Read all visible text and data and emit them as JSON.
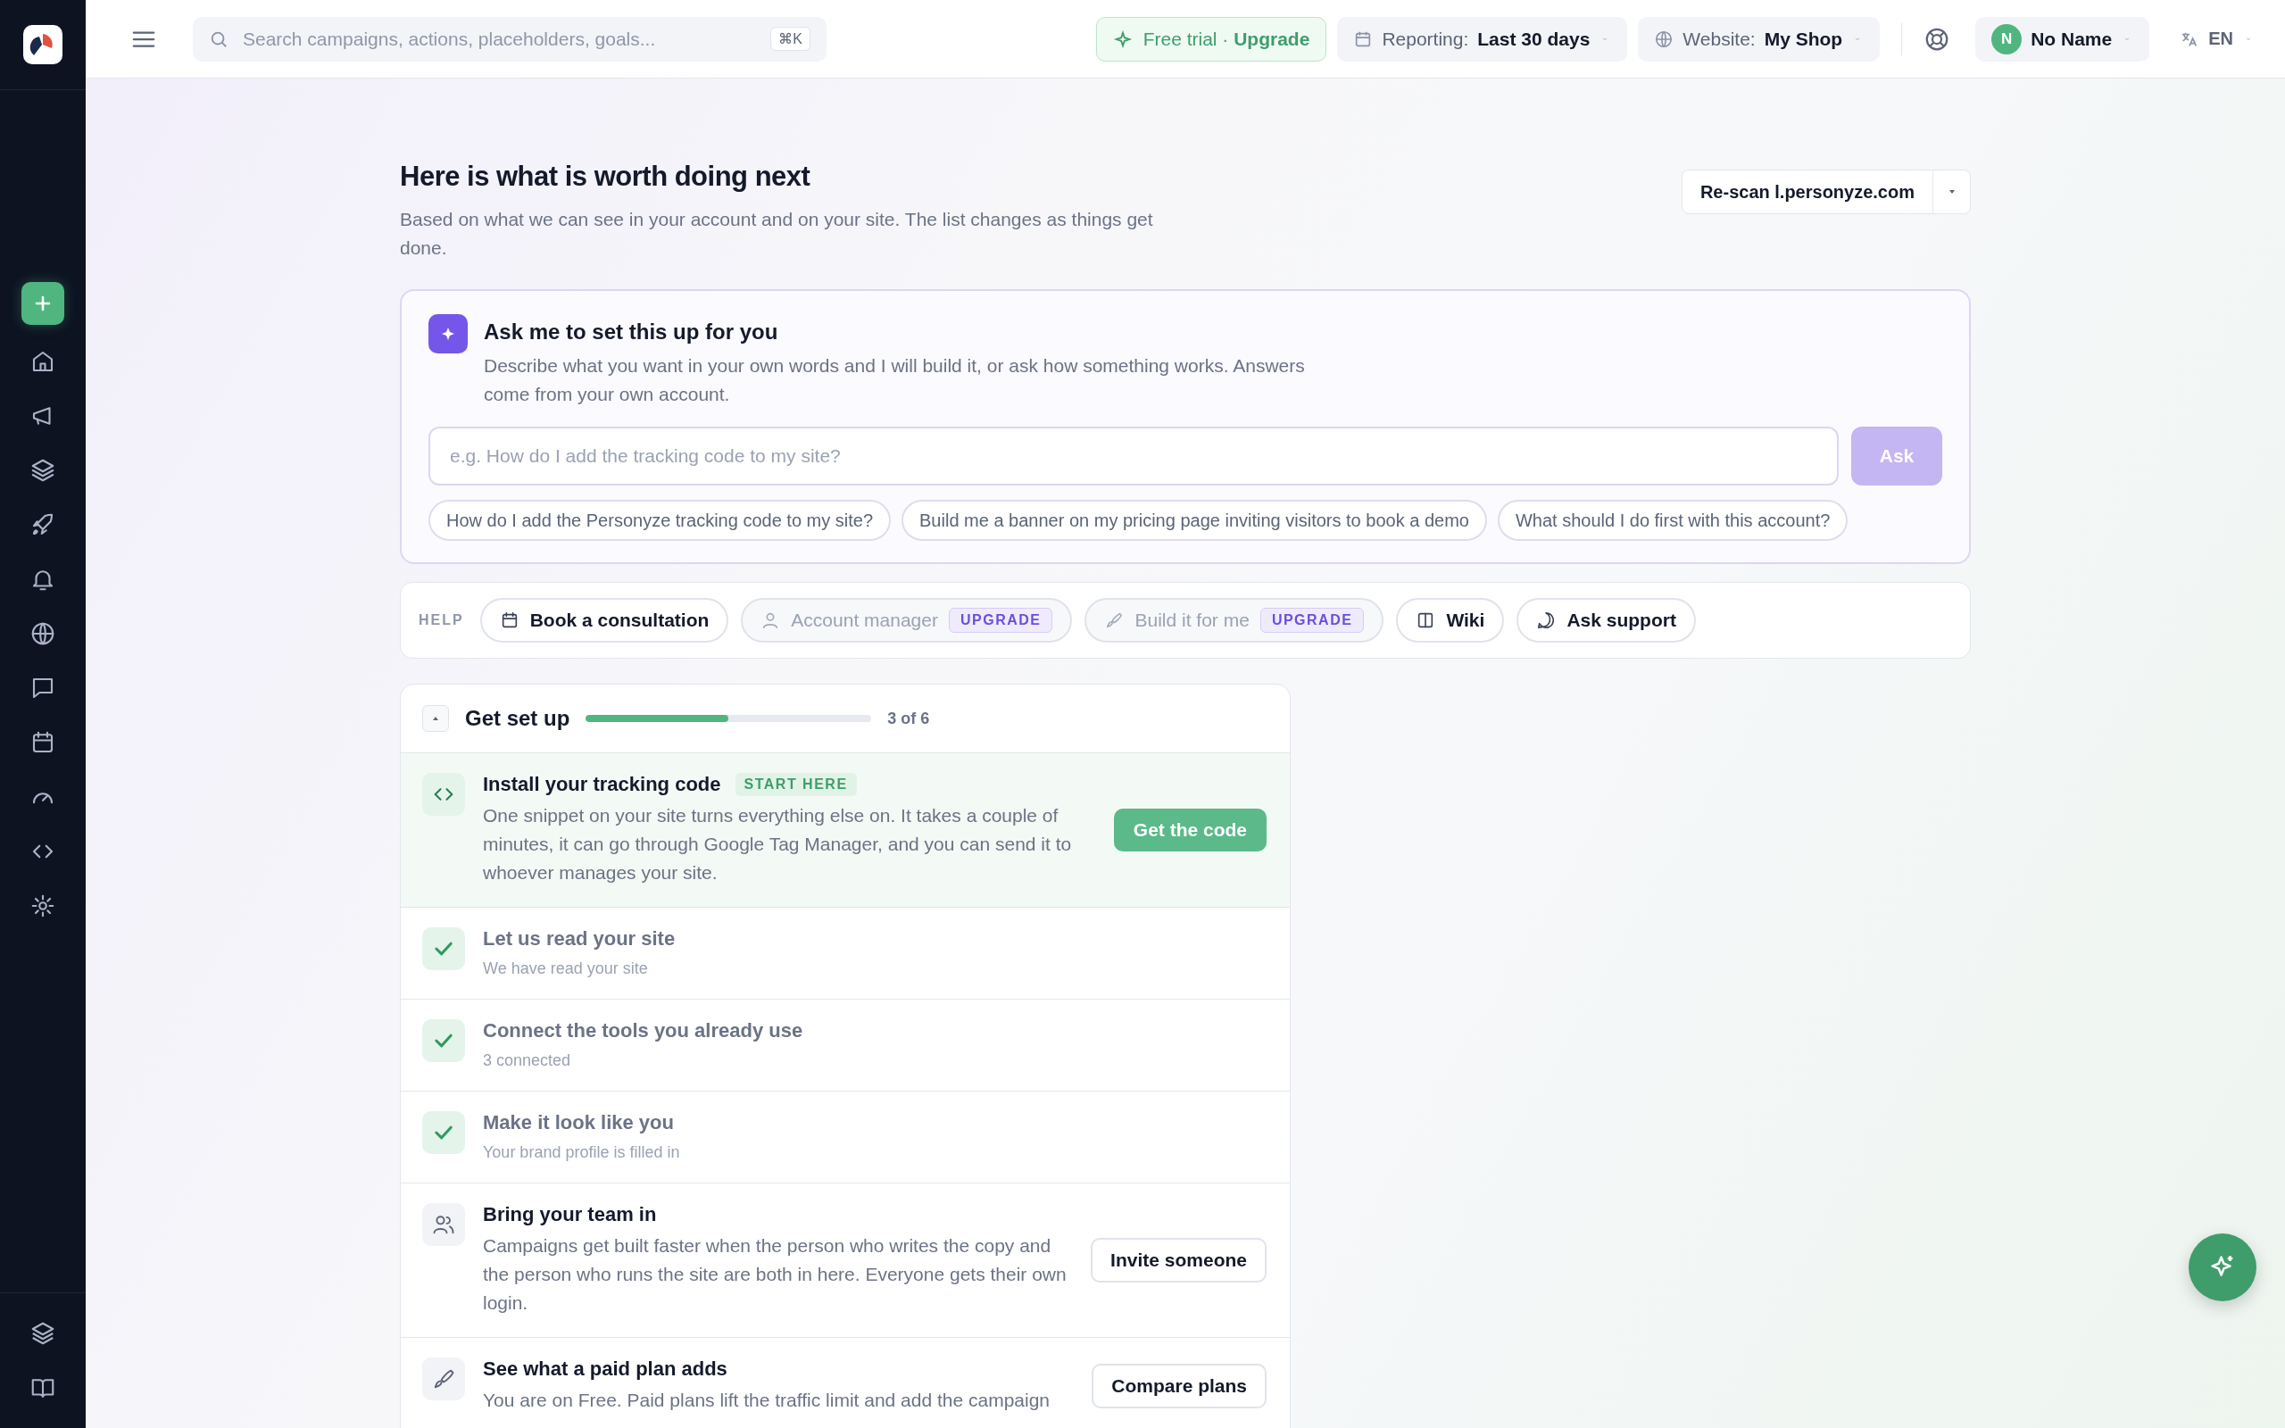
{
  "topbar": {
    "search": {
      "placeholder": "Search campaigns, actions, placeholders, goals...",
      "shortcut": "⌘K"
    },
    "trial": "Free trial · **Upgrade**",
    "reporting": {
      "label": "Reporting:",
      "value": "Last 30 days"
    },
    "website": {
      "label": "Website:",
      "value": "My Shop"
    },
    "user": {
      "initial": "N",
      "name": "No Name"
    },
    "language": "EN"
  },
  "header": {
    "title": "Here is what is worth doing next",
    "subtitle": "Based on what we can see in your account and on your site. The list changes as things get done.",
    "rescan": "Re-scan l.personyze.com"
  },
  "assistant": {
    "title": "Ask me to set this up for you",
    "description": "Describe what you want in your own words and I will build it, or ask how something works. Answers come from your own account.",
    "placeholder": "e.g. How do I add the tracking code to my site?",
    "button": "Ask",
    "button_disabled": true,
    "suggestions": [
      "How do I add the Personyze tracking code to my site?",
      "Build me a banner on my pricing page inviting visitors to book a demo",
      "What should I do first with this account?"
    ]
  },
  "help": {
    "label": "HELP",
    "items": [
      {
        "label": "Book a consultation",
        "disabled": false
      },
      {
        "label": "Account manager",
        "disabled": true,
        "badge": "UPGRADE"
      },
      {
        "label": "Build it for me",
        "disabled": true,
        "badge": "UPGRADE"
      },
      {
        "label": "Wiki",
        "disabled": false
      },
      {
        "label": "Ask support",
        "disabled": false
      }
    ]
  },
  "setup": {
    "title": "Get set up",
    "level": 0.5,
    "progress": "3 of 6",
    "expanded": true,
    "items": [
      {
        "kind": "current",
        "title": "Install your tracking code",
        "badge": "START HERE",
        "description": "One snippet on your site turns everything else on. It takes a couple of minutes, it can go through Google Tag Manager, and you can send it to whoever manages your site.",
        "button": "Get the code",
        "done": false
      },
      {
        "kind": "done",
        "title": "Let us read your site",
        "description": "We have read your site",
        "done": true
      },
      {
        "kind": "done",
        "title": "Connect the tools you already use",
        "description": "3 connected",
        "done": true
      },
      {
        "kind": "done",
        "title": "Make it look like you",
        "description": "Your brand profile is filled in",
        "done": true
      },
      {
        "kind": "todo",
        "title": "Bring your team in",
        "description": "Campaigns get built faster when the person who writes the copy and the person who runs the site are both in here. Everyone gets their own login.",
        "button": "Invite someone",
        "done": false
      },
      {
        "kind": "todo",
        "title": "See what a paid plan adds",
        "description": "You are on Free. Paid plans lift the traffic limit and add the campaign",
        "button": "Compare plans",
        "done": false
      }
    ]
  }
}
